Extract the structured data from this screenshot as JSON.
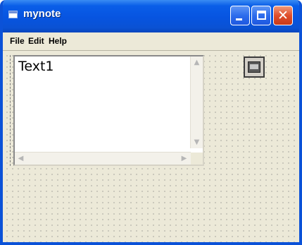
{
  "window": {
    "title": "mynote",
    "controls": {
      "minimize_icon": "minimize-icon",
      "maximize_icon": "maximize-icon",
      "close_icon": "close-icon",
      "close_glyph": "✕"
    }
  },
  "menubar": {
    "items": [
      "File",
      "Edit",
      "Help"
    ]
  },
  "form": {
    "textbox": {
      "value": "Text1"
    },
    "timer": {
      "icon": "timer-icon"
    }
  },
  "colors": {
    "titlebar": "#0754e0",
    "close_button": "#e04e2c",
    "form_background": "#ece9d8"
  }
}
